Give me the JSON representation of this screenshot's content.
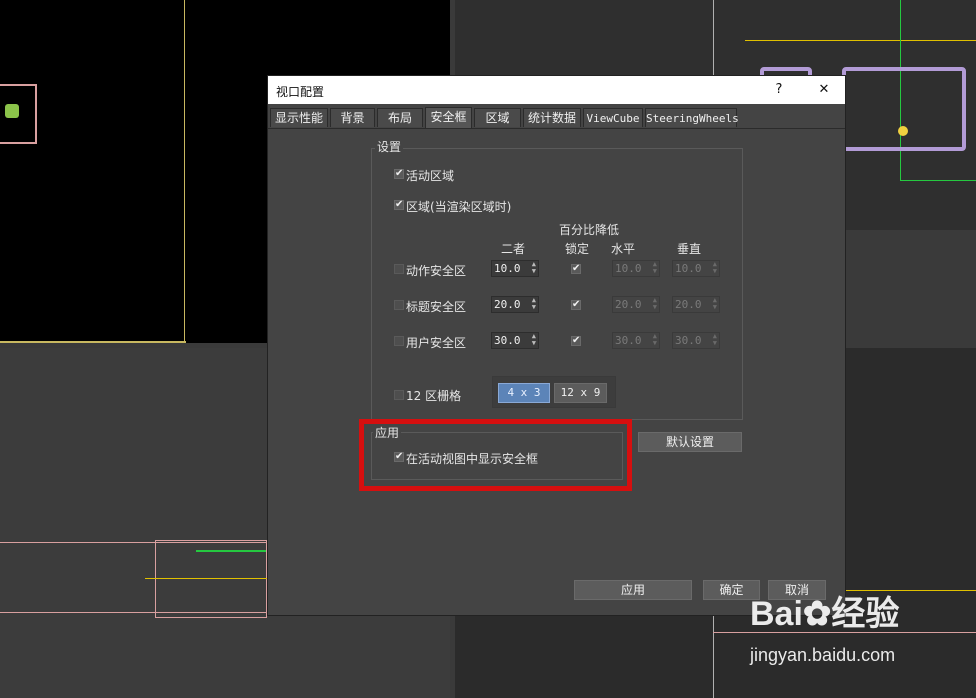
{
  "dialog": {
    "title": "视口配置",
    "help_label": "?",
    "close_label": "✕",
    "tabs": [
      "显示性能",
      "背景",
      "布局",
      "安全框",
      "区域",
      "统计数据",
      "ViewCube",
      "SteeringWheels"
    ],
    "active_tab": "安全框",
    "settings_group": {
      "label": "设置",
      "live_area": {
        "label": "活动区域",
        "checked": true
      },
      "region": {
        "label": "区域(当渲染区域时)",
        "checked": true
      },
      "percent_header": "百分比降低",
      "col_both": "二者",
      "col_lock": "锁定",
      "col_horizontal": "水平",
      "col_vertical": "垂直",
      "rows": [
        {
          "label": "动作安全区",
          "checked": false,
          "both": "10.0",
          "lock": true,
          "horizontal": "10.0",
          "vertical": "10.0"
        },
        {
          "label": "标题安全区",
          "checked": false,
          "both": "20.0",
          "lock": true,
          "horizontal": "20.0",
          "vertical": "20.0"
        },
        {
          "label": "用户安全区",
          "checked": false,
          "both": "30.0",
          "lock": true,
          "horizontal": "30.0",
          "vertical": "30.0"
        }
      ],
      "grid": {
        "label": "12 区栅格",
        "checked": false,
        "option_a": "4 x 3",
        "option_b": "12 x 9",
        "selected": "4 x 3"
      }
    },
    "apply_group": {
      "label": "应用",
      "show_in_active": {
        "label": "在活动视图中显示安全框",
        "checked": true
      }
    },
    "defaults_button": "默认设置",
    "apply_button": "应用",
    "ok_button": "确定",
    "cancel_button": "取消"
  },
  "watermark": {
    "brand": "Bai",
    "brand2": "经验",
    "url": "jingyan.baidu.com"
  },
  "colors": {
    "highlight": "#d60f0f",
    "selected_button": "#5c84b8",
    "dialog_bg": "#444444"
  }
}
